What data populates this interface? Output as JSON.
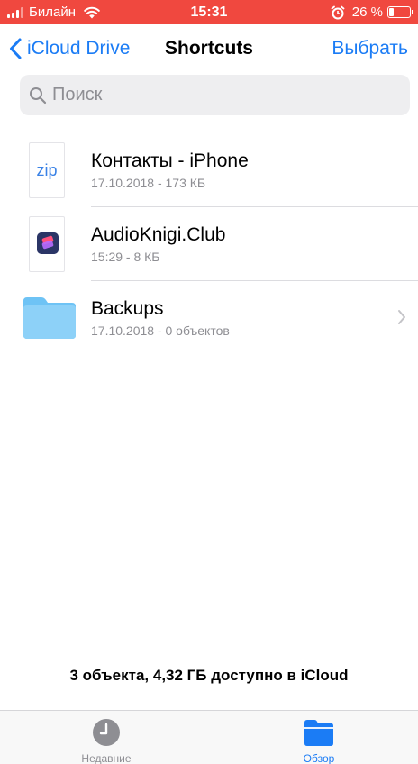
{
  "status_bar": {
    "carrier": "Билайн",
    "time": "15:31",
    "battery_percent": "26 %",
    "battery_level": 0.26,
    "icons": [
      "signal-icon",
      "wifi-icon",
      "alarm-icon",
      "battery-icon"
    ]
  },
  "nav": {
    "back_label": "iCloud Drive",
    "title": "Shortcuts",
    "select_label": "Выбрать"
  },
  "search": {
    "placeholder": "Поиск",
    "value": ""
  },
  "files": [
    {
      "name": "Контакты - iPhone",
      "meta": "17.10.2018 - 173 КБ",
      "thumb_text": "zip",
      "kind": "zip-document"
    },
    {
      "name": "AudioKnigi.Club",
      "meta": "15:29 - 8 КБ",
      "kind": "shortcut-document"
    },
    {
      "name": "Backups",
      "meta": "17.10.2018 - 0 объектов",
      "kind": "folder"
    }
  ],
  "storage_info": "3 объекта, 4,32 ГБ доступно в iCloud",
  "tabs": [
    {
      "label": "Недавние",
      "icon": "clock-icon",
      "active": false
    },
    {
      "label": "Обзор",
      "icon": "folder-icon",
      "active": true
    }
  ],
  "colors": {
    "status_bar_bg": "#f0483f",
    "accent": "#1b7cf5",
    "secondary_text": "#8e8e93",
    "folder": "#6ec3f5"
  }
}
